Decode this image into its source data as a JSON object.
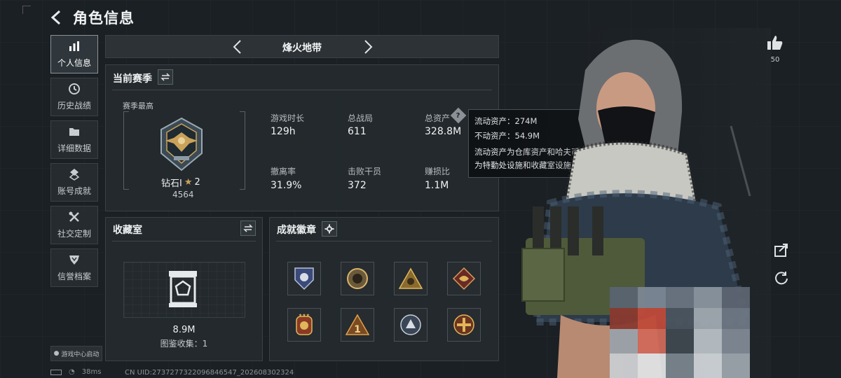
{
  "header": {
    "title": "角色信息"
  },
  "sidebar": {
    "items": [
      {
        "label": "个人信息",
        "icon": "bar-chart-icon",
        "active": true
      },
      {
        "label": "历史战绩",
        "icon": "clock-icon",
        "active": false
      },
      {
        "label": "详细数据",
        "icon": "folder-icon",
        "active": false
      },
      {
        "label": "账号成就",
        "icon": "medal-icon",
        "active": false
      },
      {
        "label": "社交定制",
        "icon": "tools-icon",
        "active": false
      },
      {
        "label": "信誉档案",
        "icon": "shield-icon",
        "active": false
      }
    ],
    "launch_tag": "游戏中心启动"
  },
  "mode": {
    "title": "烽火地带"
  },
  "season": {
    "title": "当前赛季",
    "best_label": "赛季最高",
    "rank_name": "钻石I",
    "rank_stars": "2",
    "rank_points": "4564",
    "stats": [
      {
        "label": "游戏时长",
        "value": "129h"
      },
      {
        "label": "总战局",
        "value": "611"
      },
      {
        "label": "总资产",
        "value": "328.8M"
      },
      {
        "label": "撤离率",
        "value": "31.9%"
      },
      {
        "label": "击败干员",
        "value": "372"
      },
      {
        "label": "赚损比",
        "value": "1.1M"
      }
    ]
  },
  "tooltip": {
    "liquid": "流动资产：274M",
    "fixed": "不动资产：54.9M",
    "desc_line1": "流动资产为仓库资产和哈夫币，不动资产",
    "desc_line2": "为特勤处设施和收藏室设施"
  },
  "collection": {
    "title": "收藏室",
    "value": "8.9M",
    "collect_text": "图鉴收集：1"
  },
  "achievements": {
    "title": "成就徽章",
    "badges": [
      "badge-eagle",
      "badge-round",
      "badge-triangle",
      "badge-dragon",
      "badge-stars",
      "badge-one",
      "badge-wolf",
      "badge-cross"
    ]
  },
  "right": {
    "likes": "50"
  },
  "status": {
    "ping": "38ms",
    "uid": "CN UID:2737277322096846547_202608302324"
  },
  "colors": {
    "accent_gold": "#c9a25a",
    "panel": "#242a2e",
    "bg": "#1b2024"
  }
}
